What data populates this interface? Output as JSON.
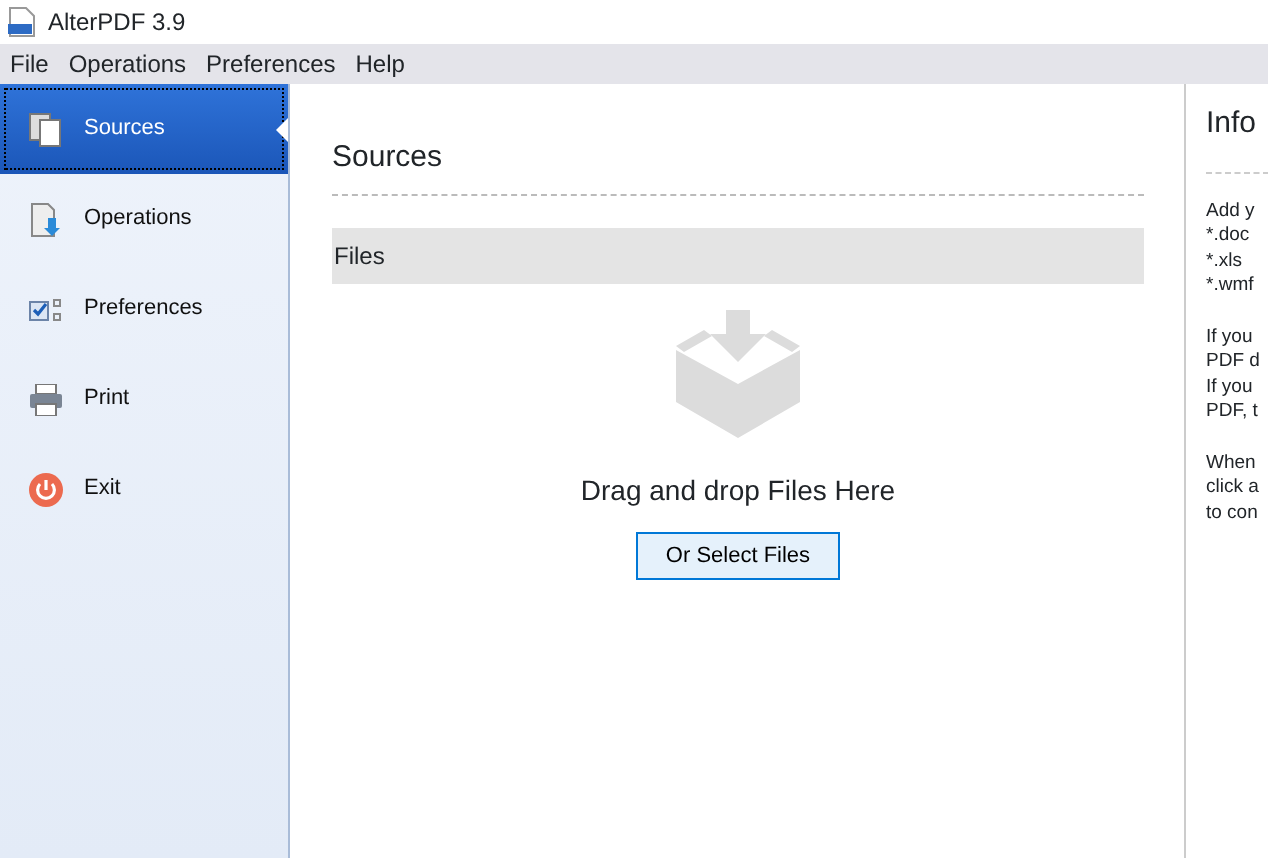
{
  "window": {
    "title": "AlterPDF 3.9"
  },
  "menu": [
    "File",
    "Operations",
    "Preferences",
    "Help"
  ],
  "sidebar": {
    "items": [
      {
        "label": "Sources",
        "kind": "sources",
        "selected": true
      },
      {
        "label": "Operations",
        "kind": "operations",
        "selected": false
      },
      {
        "label": "Preferences",
        "kind": "preferences",
        "selected": false
      },
      {
        "label": "Print",
        "kind": "print",
        "selected": false
      },
      {
        "label": "Exit",
        "kind": "exit",
        "selected": false
      }
    ]
  },
  "main": {
    "title": "Sources",
    "section": "Files",
    "drop_text": "Drag and drop Files Here",
    "button": "Or Select Files"
  },
  "info": {
    "title": "Info",
    "paragraphs": [
      [
        "Add y",
        "*.doc",
        "*.xls",
        "*.wmf"
      ],
      [
        "If you",
        "PDF d",
        "If you",
        "PDF, t"
      ],
      [
        "When",
        "click a",
        "to con"
      ]
    ]
  }
}
